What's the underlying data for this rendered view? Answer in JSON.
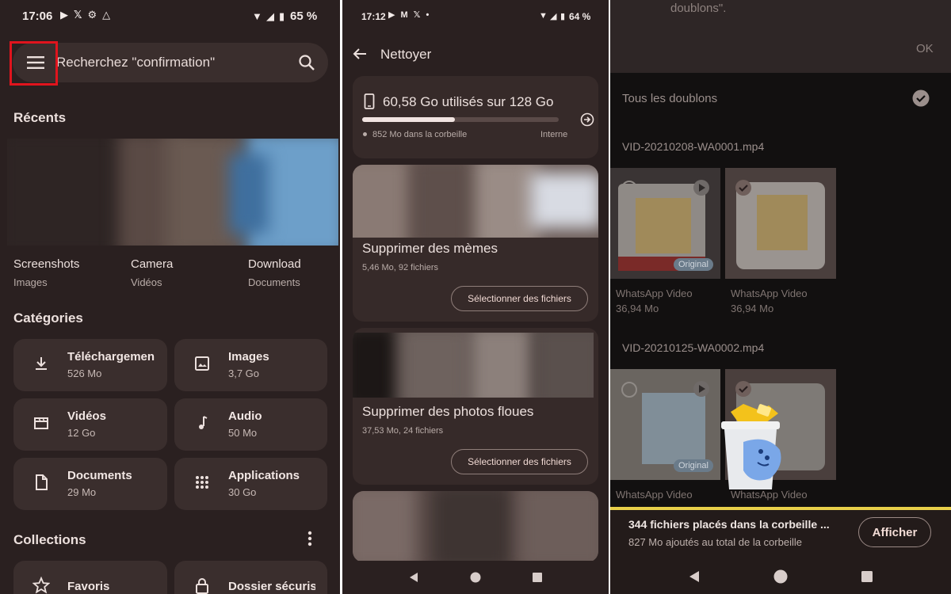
{
  "left": {
    "status": {
      "time": "17:06",
      "battery": "65 %"
    },
    "search": {
      "placeholder": "Recherchez \"confirmation\""
    },
    "recents_title": "Récents",
    "recents": [
      {
        "name": "Screenshots",
        "type": "Images"
      },
      {
        "name": "Camera",
        "type": "Vidéos"
      },
      {
        "name": "Download",
        "type": "Documents"
      }
    ],
    "categories_title": "Catégories",
    "categories": [
      {
        "name": "Téléchargemen",
        "size": "526 Mo",
        "icon": "download-icon"
      },
      {
        "name": "Images",
        "size": "3,7 Go",
        "icon": "image-icon"
      },
      {
        "name": "Vidéos",
        "size": "12 Go",
        "icon": "movie-icon"
      },
      {
        "name": "Audio",
        "size": "50 Mo",
        "icon": "music-note-icon"
      },
      {
        "name": "Documents",
        "size": "29 Mo",
        "icon": "document-icon"
      },
      {
        "name": "Applications",
        "size": "30 Go",
        "icon": "apps-grid-icon"
      }
    ],
    "collections_title": "Collections",
    "collections": [
      {
        "name": "Favoris",
        "icon": "star-icon"
      },
      {
        "name": "Dossier sécuris",
        "icon": "lock-icon"
      }
    ],
    "highlight_color": "#e0141d"
  },
  "middle": {
    "status": {
      "time": "17:12",
      "battery": "64 %"
    },
    "title": "Nettoyer",
    "storage": {
      "used_text": "60,58 Go utilisés sur 128 Go",
      "used_fraction": 0.47,
      "trash_text": "852 Mo dans la corbeille",
      "location": "Interne"
    },
    "cards": [
      {
        "title": "Supprimer des mèmes",
        "subtitle": "5,46 Mo, 92 fichiers",
        "button": "Sélectionner des fichiers"
      },
      {
        "title": "Supprimer des photos floues",
        "subtitle": "37,53 Mo, 24 fichiers",
        "button": "Sélectionner des fichiers"
      }
    ]
  },
  "right": {
    "dialog_text": "doublons\".",
    "ok_label": "OK",
    "all_duplicates_label": "Tous les doublons",
    "groups": [
      {
        "filename": "VID-20210208-WA0001.mp4",
        "items": [
          {
            "name": "WhatsApp Video",
            "size": "36,94 Mo",
            "badge": "Original",
            "checked": false
          },
          {
            "name": "WhatsApp Video",
            "size": "36,94 Mo",
            "badge": "",
            "checked": true
          }
        ]
      },
      {
        "filename": "VID-20210125-WA0002.mp4",
        "items": [
          {
            "name": "WhatsApp Video",
            "size": "",
            "badge": "Original",
            "checked": false
          },
          {
            "name": "WhatsApp Video",
            "size": "",
            "badge": "",
            "checked": true
          }
        ]
      }
    ],
    "snackbar": {
      "title": "344 fichiers placés dans la corbeille ...",
      "subtitle": "827 Mo ajoutés au total de la corbeille",
      "action": "Afficher"
    },
    "accent_color": "#e8d04a"
  }
}
